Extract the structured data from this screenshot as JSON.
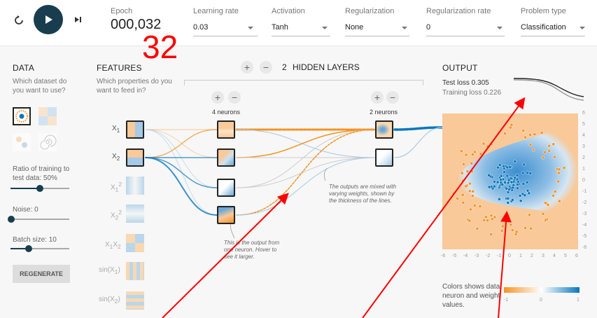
{
  "toolbar": {
    "epoch_label": "Epoch",
    "epoch_value": "000,032",
    "learning_rate_label": "Learning rate",
    "learning_rate_value": "0.03",
    "activation_label": "Activation",
    "activation_value": "Tanh",
    "regularization_label": "Regularization",
    "regularization_value": "None",
    "regularization_rate_label": "Regularization rate",
    "regularization_rate_value": "0",
    "problem_type_label": "Problem type",
    "problem_type_value": "Classification"
  },
  "overlay_number": "32",
  "data_panel": {
    "title": "DATA",
    "question": "Which dataset do you want to use?",
    "ratio_label": "Ratio of training to test data:  50%",
    "ratio_fraction": 0.5,
    "noise_label": "Noise:  0",
    "noise_fraction": 0.0,
    "batch_label": "Batch size:  10",
    "batch_fraction": 0.3,
    "regenerate_label": "REGENERATE"
  },
  "features_panel": {
    "title": "FEATURES",
    "question": "Which properties do you want to feed in?",
    "features": [
      "X1",
      "X2",
      "X1²",
      "X2²",
      "X1X2",
      "sin(X1)",
      "sin(X2)"
    ]
  },
  "hidden": {
    "count_label": "2",
    "title": "HIDDEN LAYERS",
    "layer1_neurons": "4 neurons",
    "layer2_neurons": "2 neurons",
    "note_neuron": "This is the output from one neuron. Hover to see it larger.",
    "note_weights": "The outputs are mixed with varying weights, shown by the thickness of the lines."
  },
  "output_panel": {
    "title": "OUTPUT",
    "test_loss": "Test loss 0.305",
    "training_loss": "Training loss 0.226",
    "colors_note": "Colors shows data, neuron and weight values.",
    "legend_min": "-1",
    "legend_mid": "0",
    "legend_max": "1",
    "x_ticks": [
      "-6",
      "-5",
      "-4",
      "-3",
      "-2",
      "-1",
      "0",
      "1",
      "2",
      "3",
      "4",
      "5",
      "6"
    ],
    "y_ticks": [
      "6",
      "5",
      "4",
      "3",
      "2",
      "1",
      "0",
      "-1",
      "-2",
      "-3",
      "-4",
      "-5",
      "-6"
    ]
  },
  "colors": {
    "orange": "#f59322",
    "blue": "#0877bd",
    "dark": "#183d4e",
    "annotation_red": "#ff0000"
  }
}
